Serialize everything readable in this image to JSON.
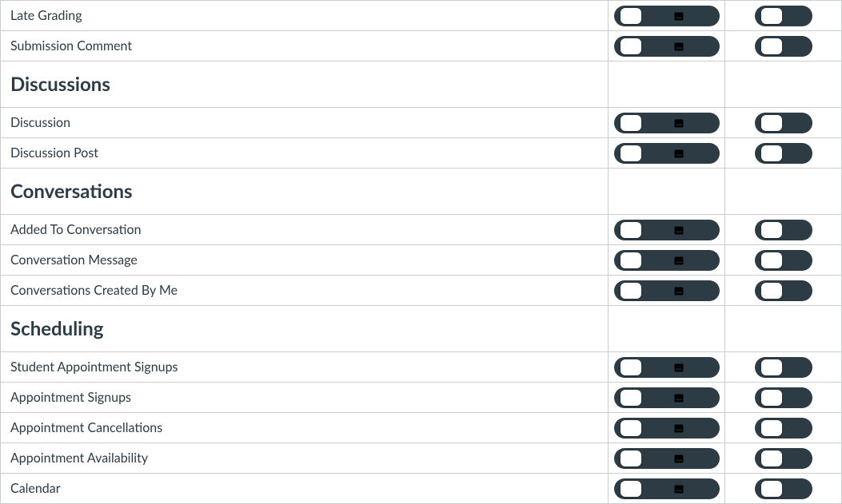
{
  "colors": {
    "pill_bg": "#2D3B45",
    "selected_bg": "#FFFFFF"
  },
  "icons": [
    "check",
    "clock",
    "calendar",
    "x"
  ],
  "pushIcons": [
    "check",
    "x"
  ],
  "rows": [
    {
      "type": "item",
      "label": "Late Grading",
      "emailSelected": 0,
      "pushSelected": 0
    },
    {
      "type": "item",
      "label": "Submission Comment",
      "emailSelected": 0,
      "pushSelected": 0
    },
    {
      "type": "header",
      "label": "Discussions"
    },
    {
      "type": "item",
      "label": "Discussion",
      "emailSelected": 0,
      "pushSelected": 0
    },
    {
      "type": "item",
      "label": "Discussion Post",
      "emailSelected": 0,
      "pushSelected": 0
    },
    {
      "type": "header",
      "label": "Conversations"
    },
    {
      "type": "item",
      "label": "Added To Conversation",
      "emailSelected": 0,
      "pushSelected": 0
    },
    {
      "type": "item",
      "label": "Conversation Message",
      "emailSelected": 0,
      "pushSelected": 0
    },
    {
      "type": "item",
      "label": "Conversations Created By Me",
      "emailSelected": 0,
      "pushSelected": 0
    },
    {
      "type": "header",
      "label": "Scheduling"
    },
    {
      "type": "item",
      "label": "Student Appointment Signups",
      "emailSelected": 0,
      "pushSelected": 0
    },
    {
      "type": "item",
      "label": "Appointment Signups",
      "emailSelected": 0,
      "pushSelected": 0
    },
    {
      "type": "item",
      "label": "Appointment Cancellations",
      "emailSelected": 0,
      "pushSelected": 0
    },
    {
      "type": "item",
      "label": "Appointment Availability",
      "emailSelected": 0,
      "pushSelected": 0
    },
    {
      "type": "item",
      "label": "Calendar",
      "emailSelected": 0,
      "pushSelected": 0
    }
  ]
}
